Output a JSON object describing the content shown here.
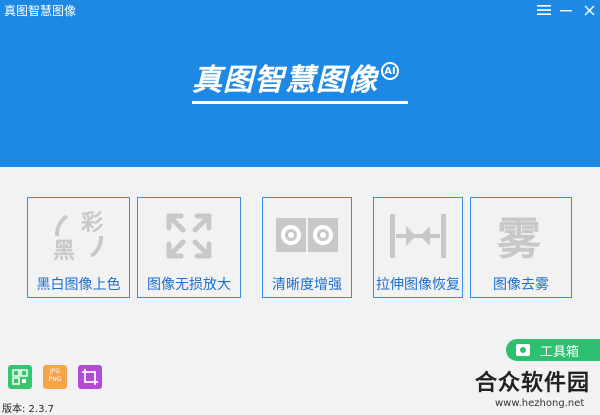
{
  "app": {
    "title": "真图智慧图像"
  },
  "window_controls": {
    "menu": "☰",
    "minimize": "—",
    "close": "×"
  },
  "logo": {
    "text": "真图智慧图像",
    "badge": "AI"
  },
  "tiles": [
    {
      "label": "黑白图像上色",
      "icon": "colorize-icon",
      "glyph_a": "黑",
      "glyph_b": "彩"
    },
    {
      "label": "图像无损放大",
      "icon": "enlarge-icon"
    },
    {
      "label": "清晰度增强",
      "icon": "sharpen-icon"
    },
    {
      "label": "拉伸图像恢复",
      "icon": "stretch-restore-icon"
    },
    {
      "label": "图像去雾",
      "icon": "dehaze-icon",
      "glyph_a": "雾"
    }
  ],
  "toolbox": {
    "label": "工具箱"
  },
  "bottom_tools": [
    {
      "icon": "qr-icon"
    },
    {
      "icon": "format-convert-icon",
      "line1": "JPG",
      "line2": "PNG"
    },
    {
      "icon": "crop-icon"
    }
  ],
  "version": {
    "text": "版本: 2.3.7"
  },
  "watermark": {
    "title": "合众软件园",
    "url": "www.hezhong.net"
  },
  "colors": {
    "header": "#1e88e5",
    "accent": "#1a6fd1",
    "toolbox": "#2fbf71"
  }
}
